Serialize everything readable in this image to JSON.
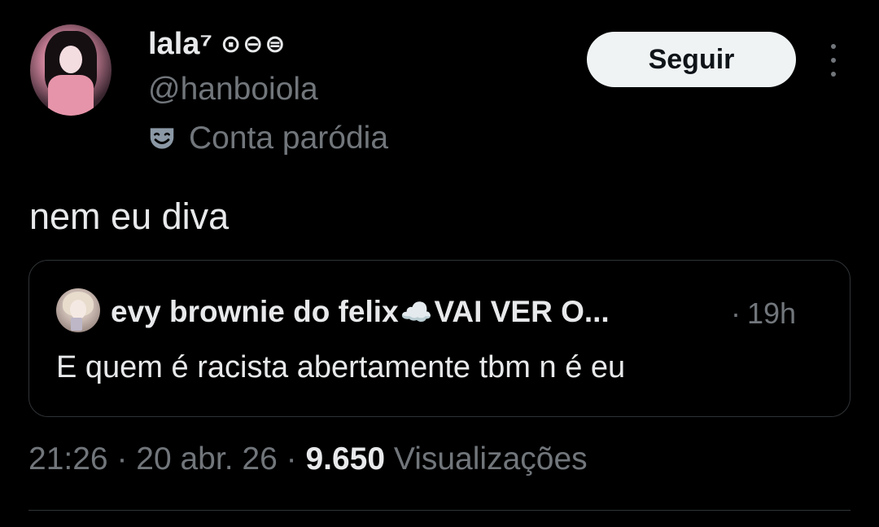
{
  "author": {
    "display_name": "lala⁷",
    "name_emojis": "⊙⊖⊜",
    "handle": "@hanboiola",
    "parody_label": "Conta paródia",
    "parody_icon": "theater-mask-icon"
  },
  "follow_button": {
    "label": "Seguir"
  },
  "more_icon": "more-vertical-icon",
  "tweet": {
    "text": "nem eu diva"
  },
  "quoted_tweet": {
    "author_name": "evy brownie do felix",
    "author_cloud": "☁️",
    "author_name_suffix": "VAI VER O...",
    "separator": "·",
    "time_ago": "19h",
    "text": "E quem é racista abertamente tbm n é eu"
  },
  "meta": {
    "time": "21:26",
    "sep1": " · ",
    "date": "20 abr. 26",
    "sep2": " · ",
    "views_count": "9.650",
    "views_label": " Visualizações"
  },
  "colors": {
    "background": "#000000",
    "primary_text": "#e7e9ea",
    "secondary_text": "#71767b",
    "border": "#2f3336",
    "button_bg": "#eff3f4"
  }
}
